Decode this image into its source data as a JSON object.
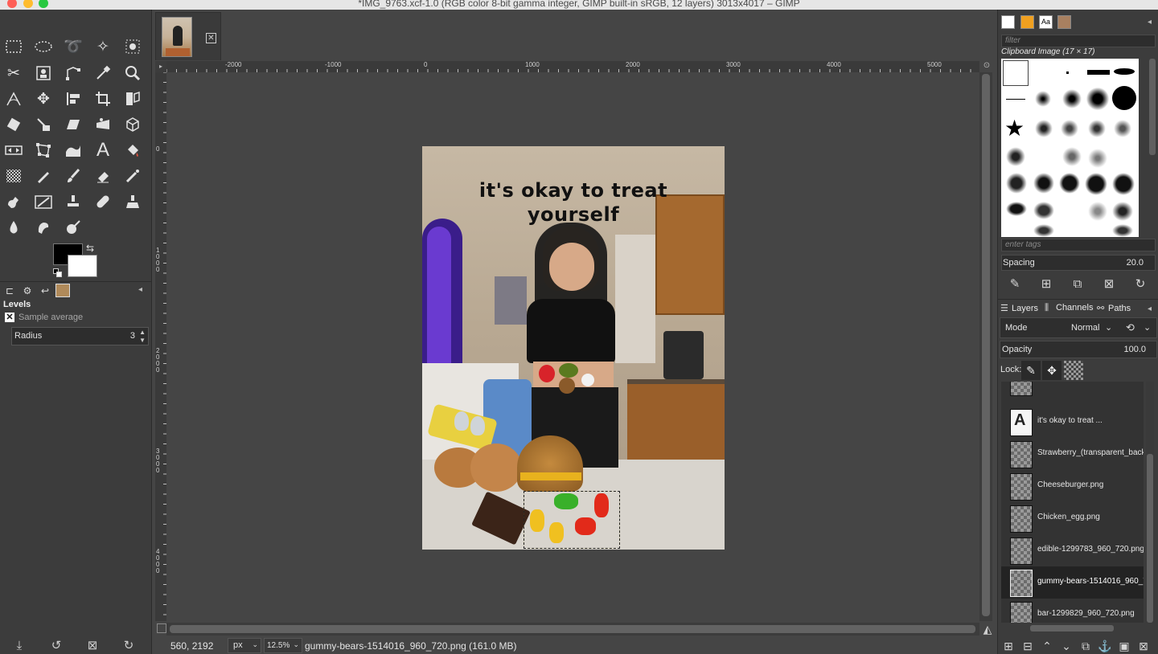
{
  "window": {
    "title": "*IMG_9763.xcf-1.0 (RGB color 8-bit gamma integer, GIMP built-in sRGB, 12 layers) 3013x4017 – GIMP"
  },
  "toolbox": {
    "tools": [
      "rect-select",
      "ellipse-select",
      "free-select",
      "fuzzy-select",
      "by-color-select",
      "scissors-select",
      "foreground-select",
      "paths",
      "color-picker",
      "zoom",
      "measure",
      "move",
      "align",
      "crop",
      "unified-transform",
      "rotate",
      "shear",
      "flip",
      "perspective",
      "3d-transform",
      "warp-transform",
      "cage-transform",
      "handle-transform",
      "text",
      "bucket-fill",
      "gradient",
      "pencil",
      "paintbrush",
      "eraser",
      "airbrush",
      "ink",
      "mypaint-brush",
      "clone",
      "heal",
      "perspective-clone",
      "blur",
      "smudge",
      "dodge-burn"
    ],
    "fg_color": "#000000",
    "bg_color": "#ffffff"
  },
  "tool_options": {
    "title": "Levels",
    "sample_average_label": "Sample average",
    "radius_label": "Radius",
    "radius_value": "3"
  },
  "rulers": {
    "h_labels": [
      "-2000",
      "-1000",
      "0",
      "1000",
      "2000",
      "3000",
      "4000",
      "5000"
    ],
    "v_labels": [
      "0",
      "1000",
      "2000",
      "3000",
      "4000"
    ]
  },
  "canvas": {
    "caption_line1": "it's okay to treat",
    "caption_line2": "yourself"
  },
  "statusbar": {
    "coords": "560, 2192",
    "unit": "px",
    "zoom": "12.5%",
    "message": "gummy-bears-1514016_960_720.png (161.0 MB)"
  },
  "brushes": {
    "filter_placeholder": "filter",
    "current_brush": "Clipboard Image (17 × 17)",
    "tags_placeholder": "enter tags",
    "spacing_label": "Spacing",
    "spacing_value": "20.0"
  },
  "layers_panel": {
    "tabs": [
      "Layers",
      "Channels",
      "Paths"
    ],
    "mode_label": "Mode",
    "mode_value": "Normal",
    "opacity_label": "Opacity",
    "opacity_value": "100.0",
    "lock_label": "Lock:",
    "layers": [
      {
        "name": "it's okay to treat ...",
        "type": "text"
      },
      {
        "name": "Strawberry_(transparent_back",
        "type": "image"
      },
      {
        "name": "Cheeseburger.png",
        "type": "image"
      },
      {
        "name": "Chicken_egg.png",
        "type": "image"
      },
      {
        "name": "edible-1299783_960_720.png",
        "type": "image"
      },
      {
        "name": "gummy-bears-1514016_960_7",
        "type": "image",
        "selected": true
      },
      {
        "name": "bar-1299829_960_720.png",
        "type": "image"
      }
    ]
  }
}
